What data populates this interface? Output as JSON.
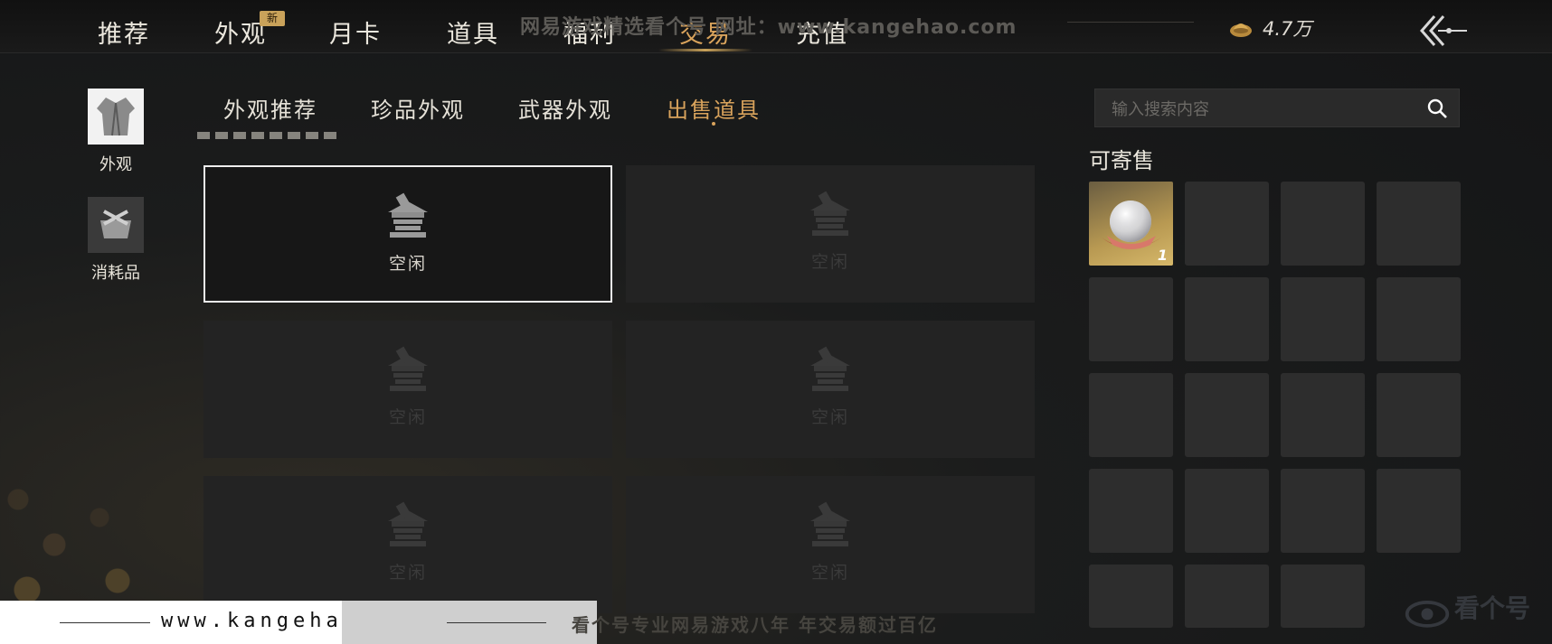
{
  "top_nav": {
    "tabs": [
      "推荐",
      "外观",
      "月卡",
      "道具",
      "福利",
      "交易",
      "充值"
    ],
    "active_tab": "交易",
    "new_badge": "新",
    "watermark": "网易游戏精选看个号 网址：www.kangehao.com",
    "currency_amount": "4.7万",
    "currency_icon": "gold-ingot-icon",
    "back_icon": "double-chevron-back-icon"
  },
  "sidebar": {
    "items": [
      {
        "label": "外观",
        "icon": "robe-icon"
      },
      {
        "label": "消耗品",
        "icon": "bundle-icon"
      }
    ]
  },
  "sub_tabs": {
    "items": [
      "外观推荐",
      "珍品外观",
      "武器外观",
      "出售道具"
    ],
    "active": "出售道具"
  },
  "stall": {
    "slot_label": "空闲",
    "slots": 6
  },
  "search": {
    "placeholder": "输入搜索内容"
  },
  "inventory": {
    "title": "可寄售",
    "items": [
      {
        "name": "pearl",
        "quantity": "1"
      }
    ]
  },
  "footer": {
    "url": "www.kangehao.com",
    "slogan": "看个号专业网易游戏八年  年交易额过百亿",
    "logo_text": "看个号"
  },
  "colors": {
    "accent_gold": "#d9a35c",
    "background": "#1b1c1c",
    "cell": "#2d2d2d"
  }
}
